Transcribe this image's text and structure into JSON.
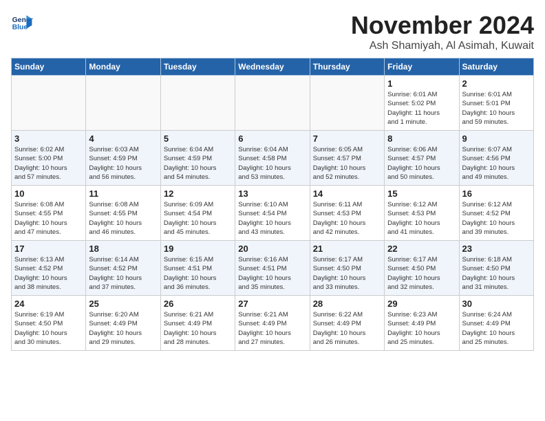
{
  "header": {
    "logo_line1": "General",
    "logo_line2": "Blue",
    "month": "November 2024",
    "location": "Ash Shamiyah, Al Asimah, Kuwait"
  },
  "weekdays": [
    "Sunday",
    "Monday",
    "Tuesday",
    "Wednesday",
    "Thursday",
    "Friday",
    "Saturday"
  ],
  "weeks": [
    [
      {
        "day": "",
        "info": ""
      },
      {
        "day": "",
        "info": ""
      },
      {
        "day": "",
        "info": ""
      },
      {
        "day": "",
        "info": ""
      },
      {
        "day": "",
        "info": ""
      },
      {
        "day": "1",
        "info": "Sunrise: 6:01 AM\nSunset: 5:02 PM\nDaylight: 11 hours\nand 1 minute."
      },
      {
        "day": "2",
        "info": "Sunrise: 6:01 AM\nSunset: 5:01 PM\nDaylight: 10 hours\nand 59 minutes."
      }
    ],
    [
      {
        "day": "3",
        "info": "Sunrise: 6:02 AM\nSunset: 5:00 PM\nDaylight: 10 hours\nand 57 minutes."
      },
      {
        "day": "4",
        "info": "Sunrise: 6:03 AM\nSunset: 4:59 PM\nDaylight: 10 hours\nand 56 minutes."
      },
      {
        "day": "5",
        "info": "Sunrise: 6:04 AM\nSunset: 4:59 PM\nDaylight: 10 hours\nand 54 minutes."
      },
      {
        "day": "6",
        "info": "Sunrise: 6:04 AM\nSunset: 4:58 PM\nDaylight: 10 hours\nand 53 minutes."
      },
      {
        "day": "7",
        "info": "Sunrise: 6:05 AM\nSunset: 4:57 PM\nDaylight: 10 hours\nand 52 minutes."
      },
      {
        "day": "8",
        "info": "Sunrise: 6:06 AM\nSunset: 4:57 PM\nDaylight: 10 hours\nand 50 minutes."
      },
      {
        "day": "9",
        "info": "Sunrise: 6:07 AM\nSunset: 4:56 PM\nDaylight: 10 hours\nand 49 minutes."
      }
    ],
    [
      {
        "day": "10",
        "info": "Sunrise: 6:08 AM\nSunset: 4:55 PM\nDaylight: 10 hours\nand 47 minutes."
      },
      {
        "day": "11",
        "info": "Sunrise: 6:08 AM\nSunset: 4:55 PM\nDaylight: 10 hours\nand 46 minutes."
      },
      {
        "day": "12",
        "info": "Sunrise: 6:09 AM\nSunset: 4:54 PM\nDaylight: 10 hours\nand 45 minutes."
      },
      {
        "day": "13",
        "info": "Sunrise: 6:10 AM\nSunset: 4:54 PM\nDaylight: 10 hours\nand 43 minutes."
      },
      {
        "day": "14",
        "info": "Sunrise: 6:11 AM\nSunset: 4:53 PM\nDaylight: 10 hours\nand 42 minutes."
      },
      {
        "day": "15",
        "info": "Sunrise: 6:12 AM\nSunset: 4:53 PM\nDaylight: 10 hours\nand 41 minutes."
      },
      {
        "day": "16",
        "info": "Sunrise: 6:12 AM\nSunset: 4:52 PM\nDaylight: 10 hours\nand 39 minutes."
      }
    ],
    [
      {
        "day": "17",
        "info": "Sunrise: 6:13 AM\nSunset: 4:52 PM\nDaylight: 10 hours\nand 38 minutes."
      },
      {
        "day": "18",
        "info": "Sunrise: 6:14 AM\nSunset: 4:52 PM\nDaylight: 10 hours\nand 37 minutes."
      },
      {
        "day": "19",
        "info": "Sunrise: 6:15 AM\nSunset: 4:51 PM\nDaylight: 10 hours\nand 36 minutes."
      },
      {
        "day": "20",
        "info": "Sunrise: 6:16 AM\nSunset: 4:51 PM\nDaylight: 10 hours\nand 35 minutes."
      },
      {
        "day": "21",
        "info": "Sunrise: 6:17 AM\nSunset: 4:50 PM\nDaylight: 10 hours\nand 33 minutes."
      },
      {
        "day": "22",
        "info": "Sunrise: 6:17 AM\nSunset: 4:50 PM\nDaylight: 10 hours\nand 32 minutes."
      },
      {
        "day": "23",
        "info": "Sunrise: 6:18 AM\nSunset: 4:50 PM\nDaylight: 10 hours\nand 31 minutes."
      }
    ],
    [
      {
        "day": "24",
        "info": "Sunrise: 6:19 AM\nSunset: 4:50 PM\nDaylight: 10 hours\nand 30 minutes."
      },
      {
        "day": "25",
        "info": "Sunrise: 6:20 AM\nSunset: 4:49 PM\nDaylight: 10 hours\nand 29 minutes."
      },
      {
        "day": "26",
        "info": "Sunrise: 6:21 AM\nSunset: 4:49 PM\nDaylight: 10 hours\nand 28 minutes."
      },
      {
        "day": "27",
        "info": "Sunrise: 6:21 AM\nSunset: 4:49 PM\nDaylight: 10 hours\nand 27 minutes."
      },
      {
        "day": "28",
        "info": "Sunrise: 6:22 AM\nSunset: 4:49 PM\nDaylight: 10 hours\nand 26 minutes."
      },
      {
        "day": "29",
        "info": "Sunrise: 6:23 AM\nSunset: 4:49 PM\nDaylight: 10 hours\nand 25 minutes."
      },
      {
        "day": "30",
        "info": "Sunrise: 6:24 AM\nSunset: 4:49 PM\nDaylight: 10 hours\nand 25 minutes."
      }
    ]
  ]
}
